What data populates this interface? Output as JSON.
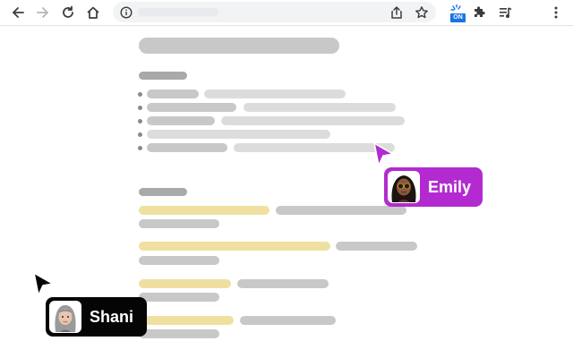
{
  "browser": {
    "extension_badge": "ON",
    "icons": [
      "back-icon",
      "forward-icon",
      "reload-icon",
      "home-icon",
      "info-icon",
      "share-icon",
      "star-icon",
      "extension-on-icon",
      "puzzle-icon",
      "media-queue-icon",
      "menu-icon"
    ]
  },
  "collaborators": [
    {
      "name": "Emily",
      "color": "#b32bd0"
    },
    {
      "name": "Shani",
      "color": "#050505"
    }
  ],
  "colors": {
    "highlight": "#efe0a0",
    "placeholder": "#c8c8c8"
  }
}
